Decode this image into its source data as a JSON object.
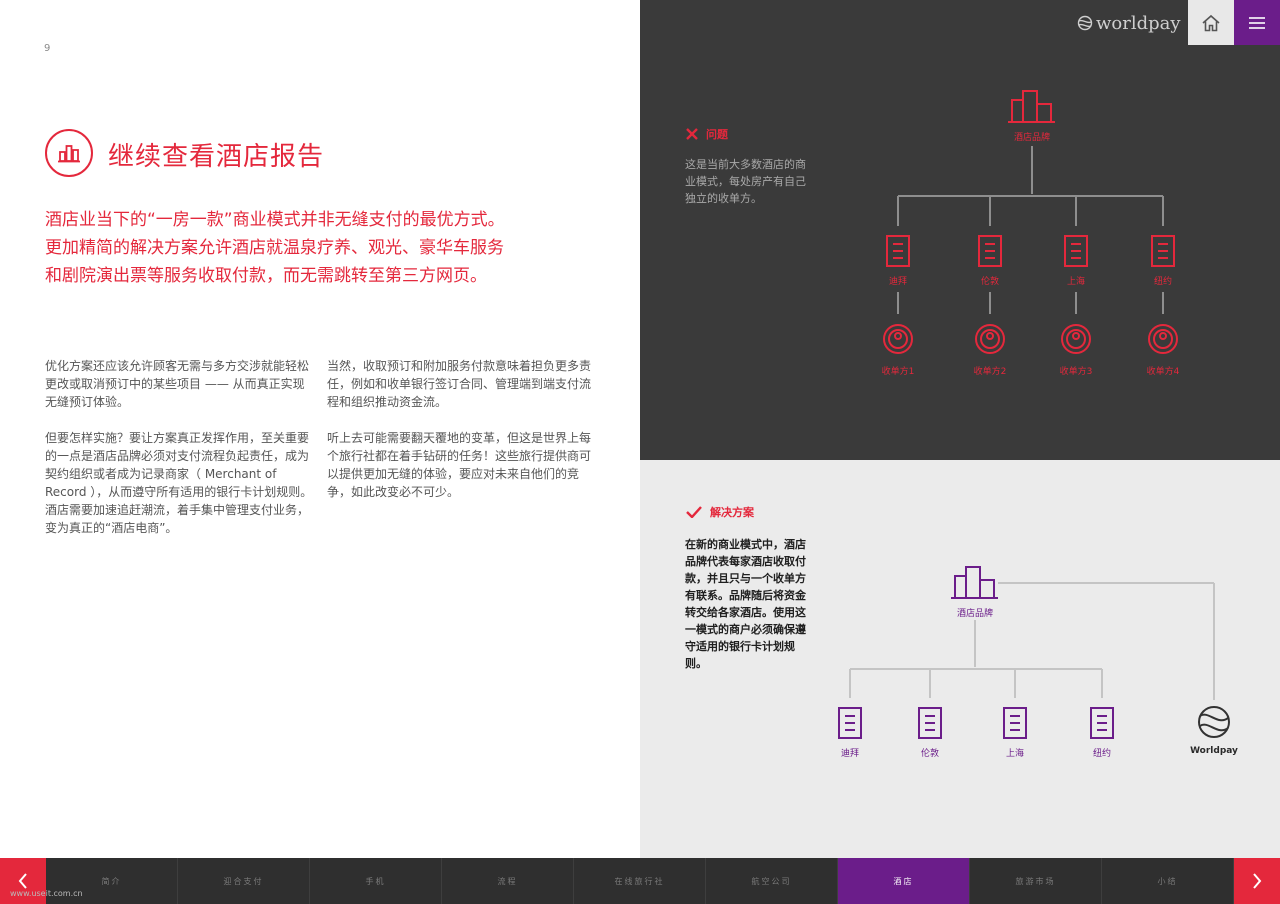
{
  "page_number": "9",
  "title": "继续查看酒店报告",
  "lead": "酒店业当下的“一房一款”商业模式并非无缝支付的最优方式。更加精简的解决方案允许酒店就温泉疗养、观光、豪华车服务和剧院演出票等服务收取付款，而无需跳转至第三方网页。",
  "col1": {
    "p1": "优化方案还应该允许顾客无需与多方交涉就能轻松更改或取消预订中的某些项目 —— 从而真正实现无缝预订体验。",
    "p2": "但要怎样实施？要让方案真正发挥作用，至关重要的一点是酒店品牌必须对支付流程负起责任，成为契约组织或者成为记录商家（ Merchant of Record ），从而遵守所有适用的银行卡计划规则。酒店需要加速追赶潮流，着手集中管理支付业务，变为真正的“酒店电商”。"
  },
  "col2": {
    "p1": "当然，收取预订和附加服务付款意味着担负更多责任，例如和收单银行签订合同、管理端到端支付流程和组织推动资金流。",
    "p2": "听上去可能需要翻天覆地的变革，但这是世界上每个旅行社都在着手钻研的任务！这些旅行提供商可以提供更加无缝的体验，要应对未来自他们的竞争，如此改变必不可少。"
  },
  "header": {
    "brand": "worldpay"
  },
  "problem": {
    "heading": "问题",
    "text": "这是当前大多数酒店的商业模式，每处房产有自己独立的收单方。",
    "brand_label": "酒店品牌",
    "cities": [
      "迪拜",
      "伦敦",
      "上海",
      "纽约"
    ],
    "acquirers": [
      "收单方1",
      "收单方2",
      "收单方3",
      "收单方4"
    ]
  },
  "solution": {
    "heading": "解决方案",
    "text": "在新的商业模式中，酒店品牌代表每家酒店收取付款，并且只与一个收单方有联系。品牌随后将资金转交给各家酒店。使用这一模式的商户必须确保遵守适用的银行卡计划规则。",
    "brand_label": "酒店品牌",
    "cities": [
      "迪拜",
      "伦敦",
      "上海",
      "纽约"
    ],
    "worldpay_label": "Worldpay"
  },
  "nav": {
    "items": [
      "简介",
      "迎合支付",
      "手机",
      "流程",
      "在线旅行社",
      "航空公司",
      "酒店",
      "旅游市场",
      "小结"
    ],
    "active_index": 6
  },
  "watermark": "www.useit.com.cn",
  "colors": {
    "accent_red": "#e4283c",
    "accent_purple": "#6b1d8a",
    "dark_panel": "#3a3a3a",
    "light_panel": "#ebebeb"
  }
}
